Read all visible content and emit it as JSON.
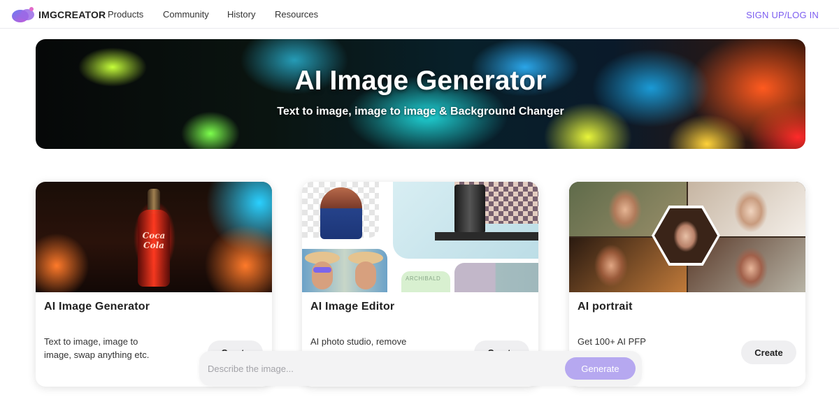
{
  "nav": {
    "logo_text": "IMGCREATOR",
    "links": [
      "Products",
      "Community",
      "History",
      "Resources"
    ],
    "signup": "SIGN UP/LOG IN"
  },
  "hero": {
    "title": "AI Image Generator",
    "subtitle": "Text to image, image to image & Background Changer"
  },
  "cards": [
    {
      "title": "AI Image Generator",
      "description": "Text to image, image to image, swap anything etc.",
      "button": "Create",
      "image_label": "Coca Cola"
    },
    {
      "title": "AI Image Editor",
      "description": "AI photo studio, remove background, magic",
      "button": "Create",
      "image_label": "ARCHIBALD"
    },
    {
      "title": "AI portrait",
      "description": "Get 100+ AI PFP",
      "button": "Create"
    }
  ],
  "prompt": {
    "placeholder": "Describe the image...",
    "button": "Generate"
  },
  "colors": {
    "accent": "#7b5cf0",
    "generate_button": "#b6a8f0",
    "card_button_bg": "#efeff1"
  }
}
